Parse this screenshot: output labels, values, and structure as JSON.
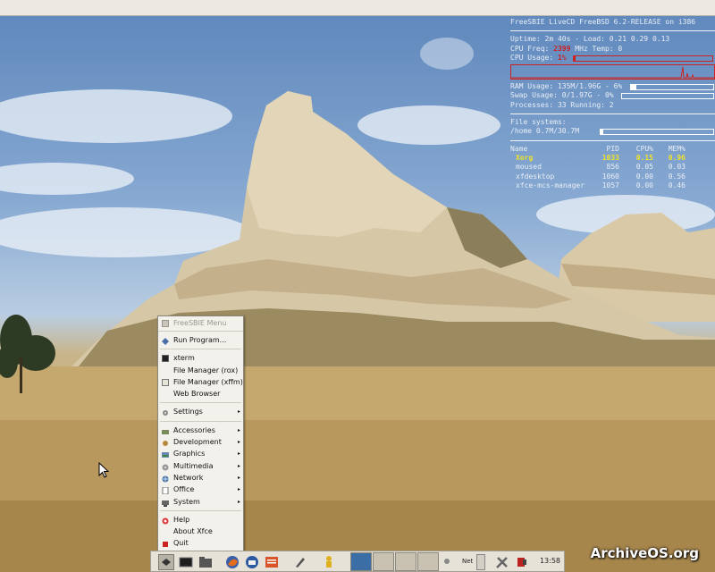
{
  "watermark": "ArchiveOS.org",
  "conky": {
    "header": "FreeSBIE LiveCD   FreeBSD 6.2-RELEASE on i386",
    "uptime_line": "Uptime: 2m 40s - Load: 0.21 0.29 0.13",
    "cpu_freq_label": "CPU Freq: ",
    "cpu_freq_value": "2399",
    "cpu_freq_unit": " MHz Temp: 0",
    "cpu_usage_label": "CPU Usage: ",
    "cpu_usage_value": "1%",
    "cpu_usage_fraction": 0.01,
    "ram_line": "RAM Usage: 135M/1.96G - 6%",
    "ram_fraction": 0.06,
    "swap_line": "Swap Usage: 0/1.97G - 0%",
    "swap_fraction": 0.0,
    "processes_line": "Processes: 33  Running: 2",
    "fs_title": "File systems:",
    "fs_line": "/home 0.7M/30.7M",
    "fs_fraction": 0.02,
    "proc_headers": [
      "Name",
      "PID",
      "CPU%",
      "MEM%"
    ],
    "processes": [
      {
        "name": "Xorg",
        "pid": "1033",
        "cpu": "0.15",
        "mem": "0.96"
      },
      {
        "name": "moused",
        "pid": "856",
        "cpu": "0.05",
        "mem": "0.03"
      },
      {
        "name": "xfdesktop",
        "pid": "1060",
        "cpu": "0.00",
        "mem": "0.56"
      },
      {
        "name": "xfce-mcs-manager",
        "pid": "1057",
        "cpu": "0.00",
        "mem": "0.46"
      }
    ]
  },
  "menu": {
    "title": "FreeSBIE Menu",
    "items": [
      {
        "label": "Run Program...",
        "icon": "run-icon"
      },
      {
        "label": "xterm",
        "icon": "terminal-icon"
      },
      {
        "label": "File Manager (rox)",
        "icon": "file-manager-icon"
      },
      {
        "label": "File Manager (xffm)",
        "icon": "file-manager-icon"
      },
      {
        "label": "Web Browser",
        "icon": ""
      },
      {
        "label": "Settings",
        "icon": "settings-icon",
        "submenu": true
      },
      {
        "label": "Accessories",
        "icon": "accessories-icon",
        "submenu": true
      },
      {
        "label": "Development",
        "icon": "development-icon",
        "submenu": true
      },
      {
        "label": "Graphics",
        "icon": "graphics-icon",
        "submenu": true
      },
      {
        "label": "Multimedia",
        "icon": "multimedia-icon",
        "submenu": true
      },
      {
        "label": "Network",
        "icon": "network-icon",
        "submenu": true
      },
      {
        "label": "Office",
        "icon": "office-icon",
        "submenu": true
      },
      {
        "label": "System",
        "icon": "system-icon",
        "submenu": true
      },
      {
        "label": "Help",
        "icon": "help-icon"
      },
      {
        "label": "About Xfce",
        "icon": ""
      },
      {
        "label": "Quit",
        "icon": "quit-icon"
      }
    ],
    "submenu_arrow": "▸"
  },
  "taskbar": {
    "net_label": "Net",
    "clock": "13:58",
    "colors": {
      "active_desktop": "#3a6ea5",
      "desktop": "#c9c2b3"
    }
  }
}
